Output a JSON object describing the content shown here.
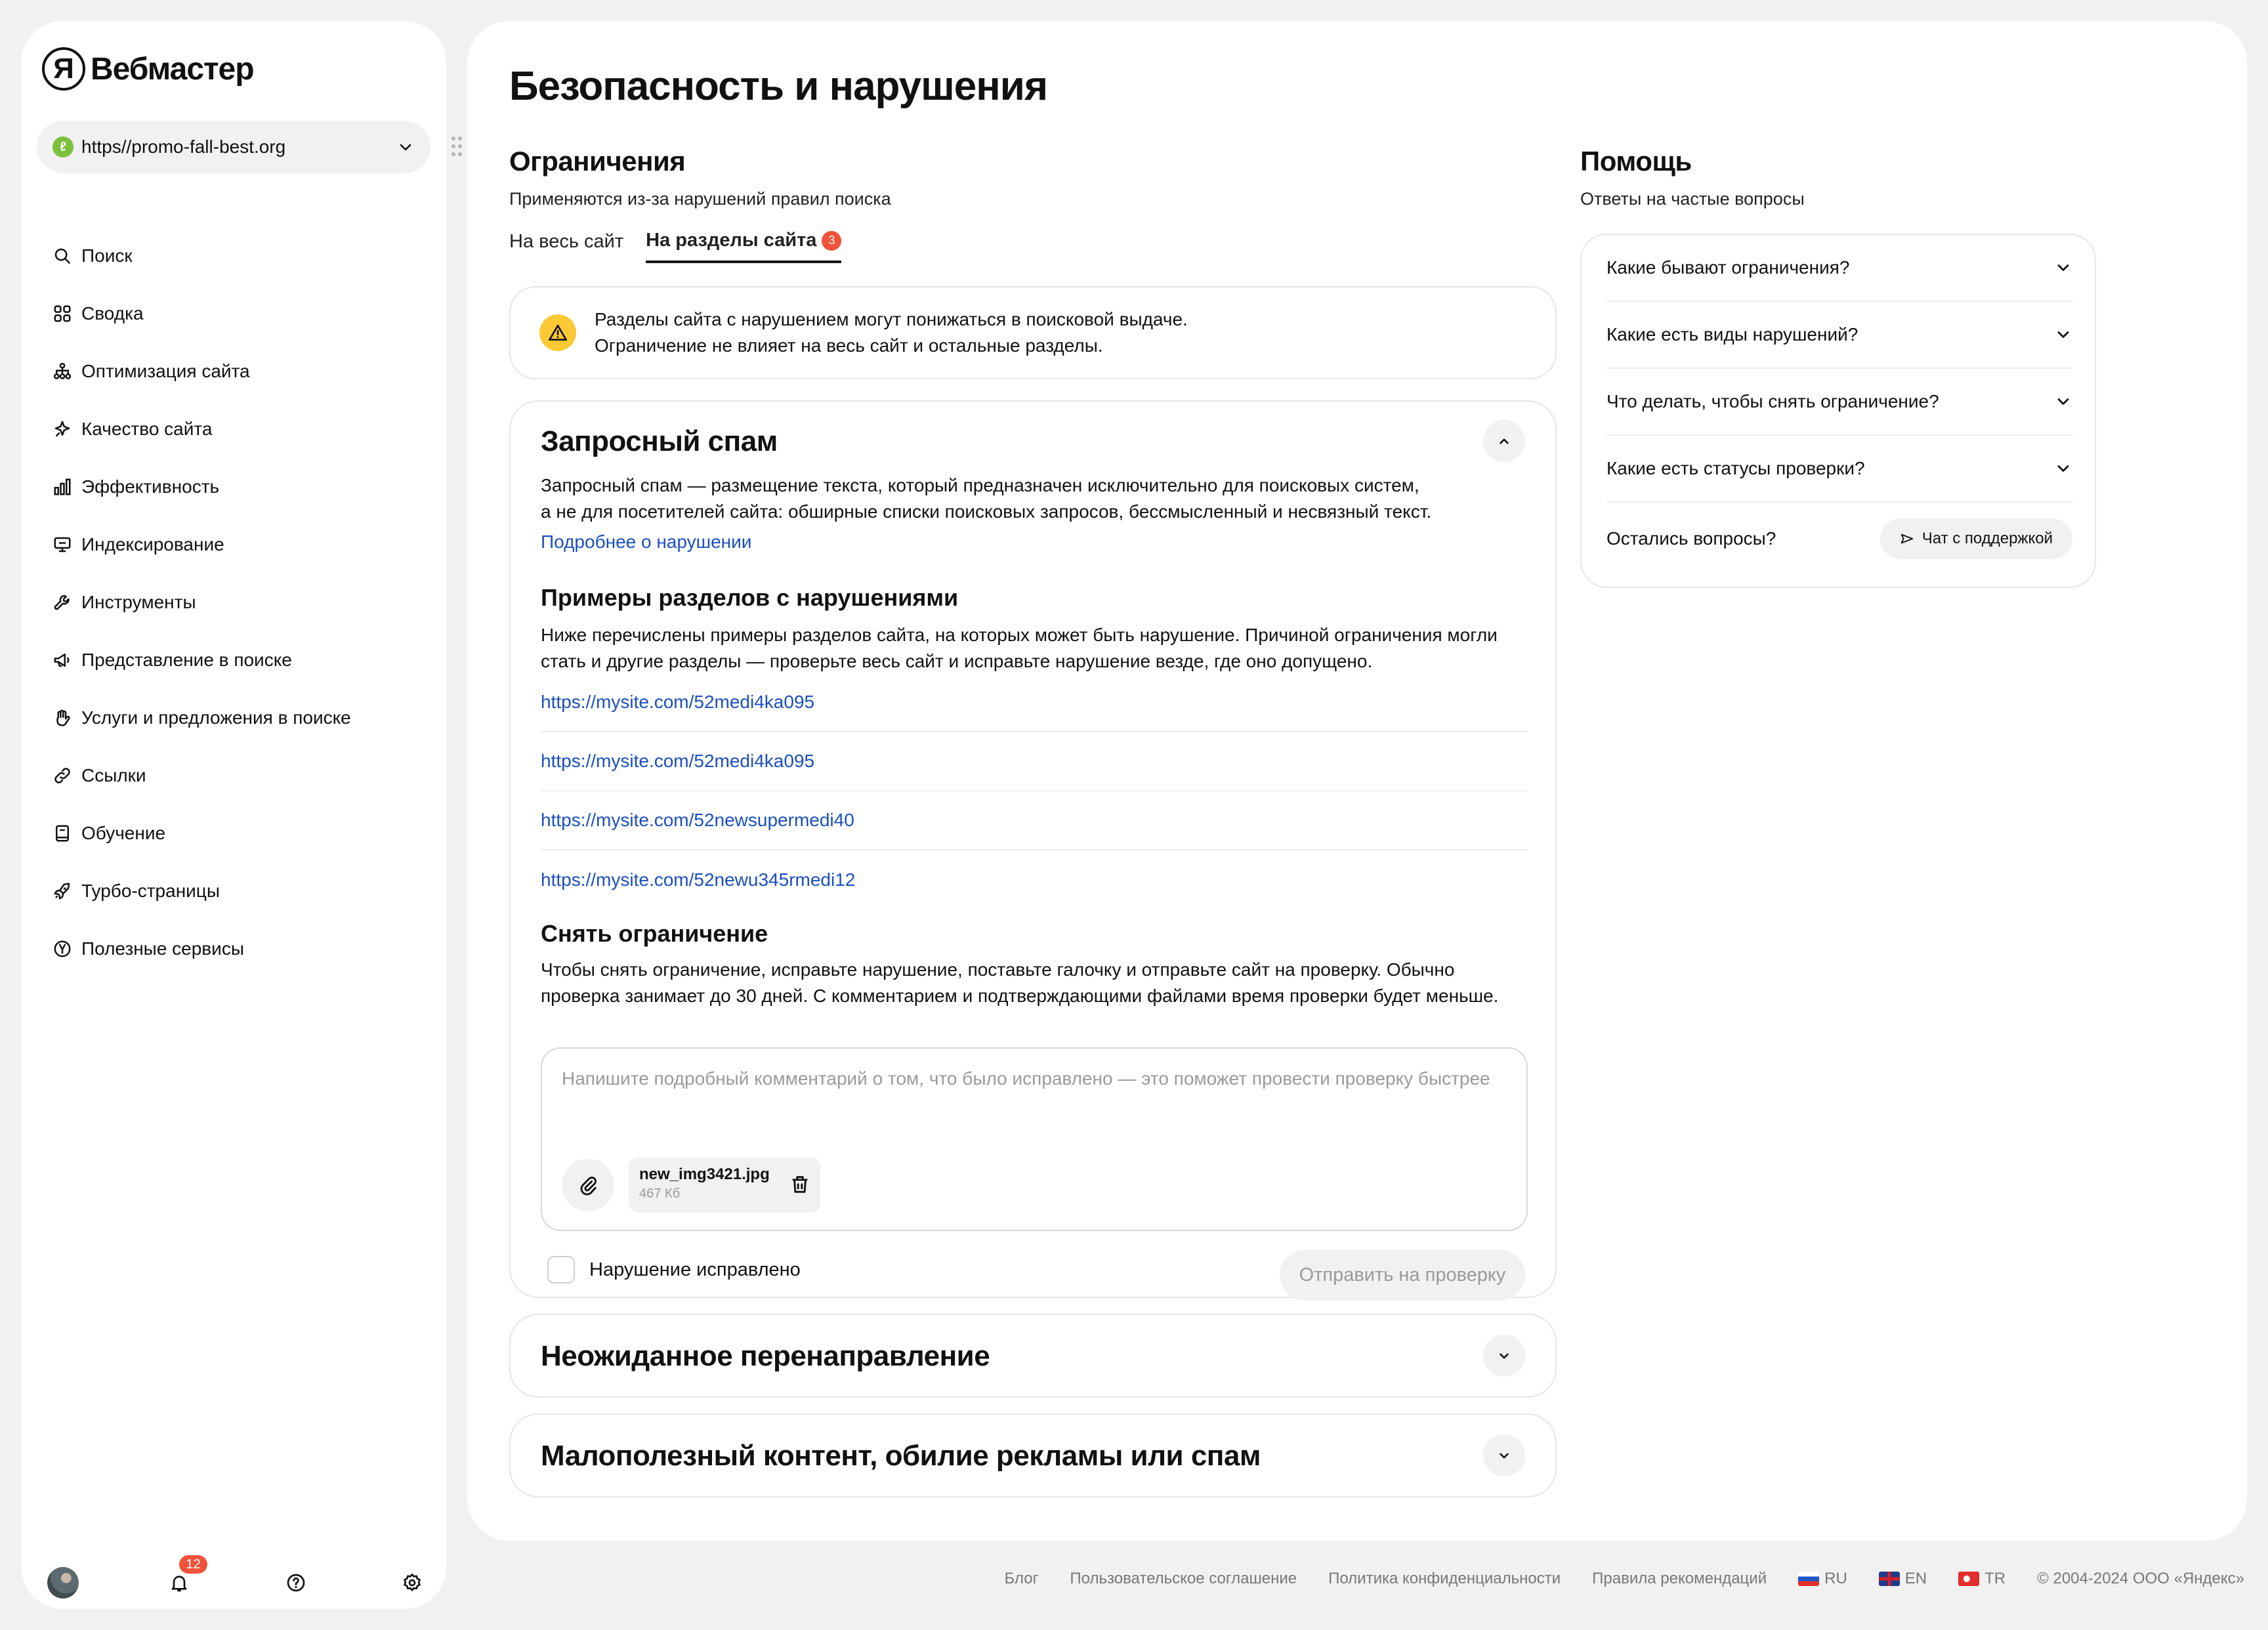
{
  "app": {
    "logo_letter": "Я",
    "name": "Вебмастер"
  },
  "site_selector": {
    "favicon": "ℓ",
    "url": "https//promo-fall-best.org"
  },
  "sidebar": {
    "items": [
      {
        "label": "Поиск",
        "icon": "search-icon"
      },
      {
        "label": "Сводка",
        "icon": "grid-icon"
      },
      {
        "label": "Оптимизация сайта",
        "icon": "hierarchy-icon"
      },
      {
        "label": "Качество сайта",
        "icon": "sparkle-icon"
      },
      {
        "label": "Эффективность",
        "icon": "bar-chart-icon"
      },
      {
        "label": "Индексирование",
        "icon": "monitor-icon"
      },
      {
        "label": "Инструменты",
        "icon": "wrench-icon"
      },
      {
        "label": "Представление в поиске",
        "icon": "megaphone-icon"
      },
      {
        "label": "Услуги и предложения в поиске",
        "icon": "hand-icon"
      },
      {
        "label": "Ссылки",
        "icon": "link-icon"
      },
      {
        "label": "Обучение",
        "icon": "book-icon"
      },
      {
        "label": "Турбо-страницы",
        "icon": "rocket-icon"
      },
      {
        "label": "Полезные сервисы",
        "icon": "yandex-circle-icon"
      }
    ],
    "notifications_count": "12"
  },
  "page": {
    "title": "Безопасность и нарушения"
  },
  "restrictions": {
    "title": "Ограничения",
    "subtitle": "Применяются из-за нарушений правил поиска",
    "tabs": [
      {
        "label": "На весь сайт",
        "active": false
      },
      {
        "label": "На разделы сайта",
        "active": true,
        "badge": "3"
      }
    ],
    "warning": {
      "line1": "Разделы сайта с нарушением могут понижаться в поисковой выдаче.",
      "line2": "Ограничение не влияет на весь сайт и остальные разделы."
    }
  },
  "violation": {
    "title": "Запросный спам",
    "description_line1": "Запросный спам — размещение текста, который предназначен исключительно для поисковых систем,",
    "description_line2": "а не для посетителей сайта: обширные списки поисковых запросов, бессмысленный и несвязный текст.",
    "more_link": "Подробнее о нарушении",
    "examples_title": "Примеры разделов с нарушениями",
    "examples_text_line1": "Ниже перечислены примеры разделов сайта, на которых может быть нарушение. Причиной ограничения могли",
    "examples_text_line2": "стать и другие разделы — проверьте весь сайт и исправьте нарушение везде, где оно допущено.",
    "urls": [
      "https://mysite.com/52medi4ka095",
      "https://mysite.com/52medi4ka095",
      "https://mysite.com/52newsupermedi40",
      "https://mysite.com/52newu345rmedi12"
    ],
    "remove_title": "Снять ограничение",
    "remove_text_line1": "Чтобы снять ограничение, исправьте нарушение, поставьте галочку и отправьте сайт на проверку. Обычно",
    "remove_text_line2": "проверка занимает до 30 дней. С комментарием и подтверждающими файлами время проверки будет меньше.",
    "comment_placeholder": "Напишите подробный комментарий о том, что было исправлено — это поможет провести проверку быстрее",
    "file": {
      "name": "new_img3421.jpg",
      "size": "467 Кб"
    },
    "checkbox_label": "Нарушение исправлено",
    "checkbox_checked": false,
    "submit_label": "Отправить на проверку"
  },
  "other_violations": [
    {
      "title": "Неожиданное перенаправление"
    },
    {
      "title": "Малополезный контент, обилие рекламы или спам"
    }
  ],
  "help": {
    "title": "Помощь",
    "subtitle": "Ответы на частые вопросы",
    "faq": [
      "Какие бывают ограничения?",
      "Какие есть виды нарушений?",
      "Что делать, чтобы снять ограничение?",
      "Какие есть статусы проверки?"
    ],
    "footer_question": "Остались вопросы?",
    "chat_button": "Чат с поддержкой"
  },
  "footer": {
    "links": [
      "Блог",
      "Пользовательское соглашение",
      "Политика конфиденциальности",
      "Правила рекомендаций"
    ],
    "langs": [
      "RU",
      "EN",
      "TR"
    ],
    "copyright": "© 2004-2024 ООО «Яндекс»"
  },
  "colors": {
    "accent_link": "#1a4fc0",
    "badge": "#f0523a",
    "warning": "#fcc934",
    "favicon": "#7cbf3c"
  }
}
